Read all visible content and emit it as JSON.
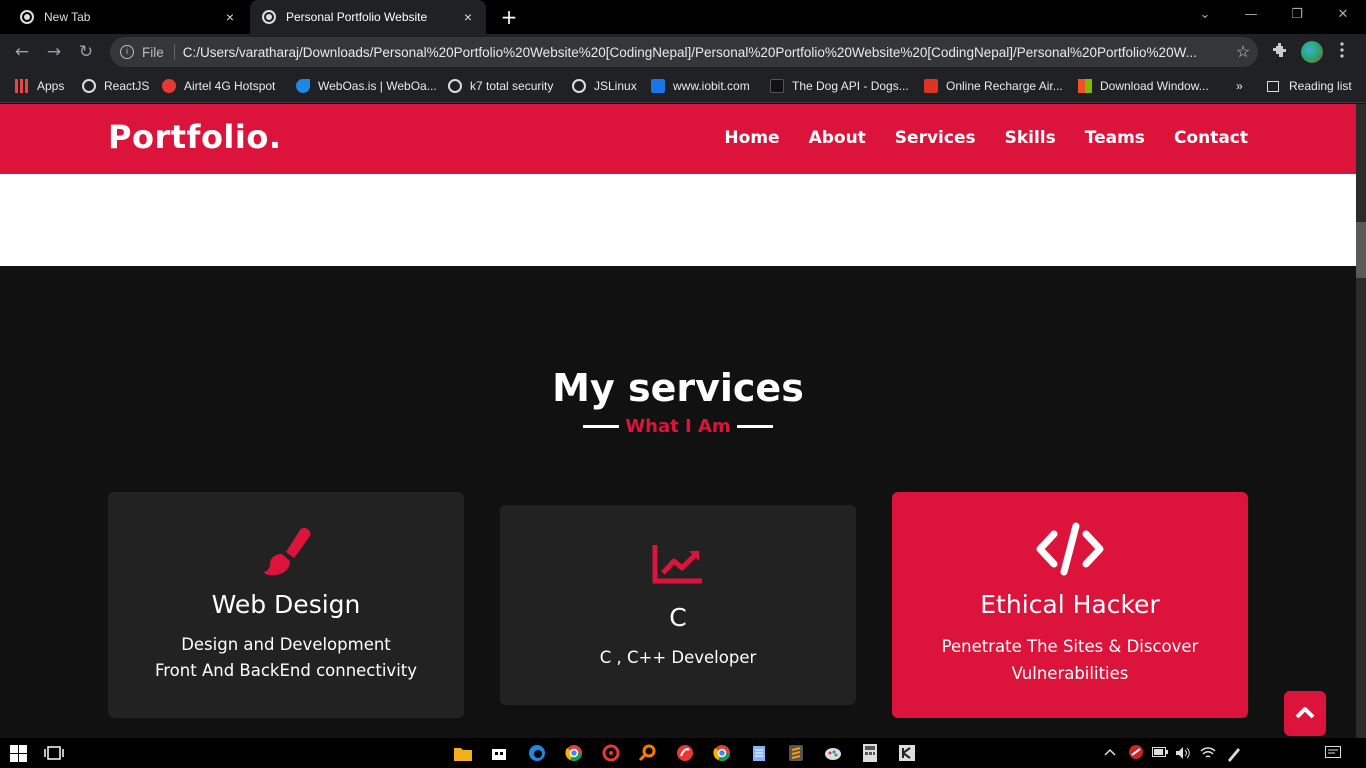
{
  "browser": {
    "tabs": [
      {
        "label": "New Tab",
        "close": "×"
      },
      {
        "label": "Personal Portfolio Website",
        "close": "×"
      }
    ],
    "new_tab": "+",
    "window_controls": {
      "minimize": "—",
      "restore": "❐",
      "close": "✕",
      "tab_search": "⌄"
    },
    "nav": {
      "back": "←",
      "forward": "→",
      "reload": "↻"
    },
    "address": {
      "scheme_label": "File",
      "url": "C:/Users/varatharaj/Downloads/Personal%20Portfolio%20Website%20[CodingNepal]/Personal%20Portfolio%20Website%20[CodingNepal]/Personal%20Portfolio%20W...",
      "star": "☆"
    },
    "bookmarks": [
      {
        "label": "Apps",
        "icon": "apps-grid-icon"
      },
      {
        "label": "ReactJS",
        "icon": "globe-icon"
      },
      {
        "label": "Airtel 4G Hotspot",
        "icon": "airtel-icon"
      },
      {
        "label": "WebOas.is | WebOa...",
        "icon": "weboasis-icon"
      },
      {
        "label": "k7 total security",
        "icon": "globe-icon"
      },
      {
        "label": "JSLinux",
        "icon": "globe-icon"
      },
      {
        "label": "www.iobit.com",
        "icon": "iobit-icon"
      },
      {
        "label": "The Dog API - Dogs...",
        "icon": "dog-icon"
      },
      {
        "label": "Online Recharge Air...",
        "icon": "airtel-icon"
      },
      {
        "label": "Download Window...",
        "icon": "windows-icon"
      }
    ],
    "bookmarks_overflow": "»",
    "reading_list": "Reading list"
  },
  "site": {
    "logo": "Portfolio.",
    "menu": [
      "Home",
      "About",
      "Services",
      "Skills",
      "Teams",
      "Contact"
    ],
    "services": {
      "title": "My services",
      "subtitle": "What I Am",
      "cards": [
        {
          "icon": "paintbrush-icon",
          "title": "Web Design",
          "lines": [
            "Design and Development",
            "Front And BackEnd connectivity"
          ]
        },
        {
          "icon": "chart-line-icon",
          "title": "C",
          "lines": [
            "C , C++ Developer"
          ]
        },
        {
          "icon": "code-icon",
          "title": "Ethical Hacker",
          "lines": [
            "Penetrate The Sites & Discover",
            "Vulnerabilities"
          ]
        }
      ]
    }
  },
  "colors": {
    "accent": "#dc143c",
    "background": "#111111",
    "card": "#222222"
  }
}
